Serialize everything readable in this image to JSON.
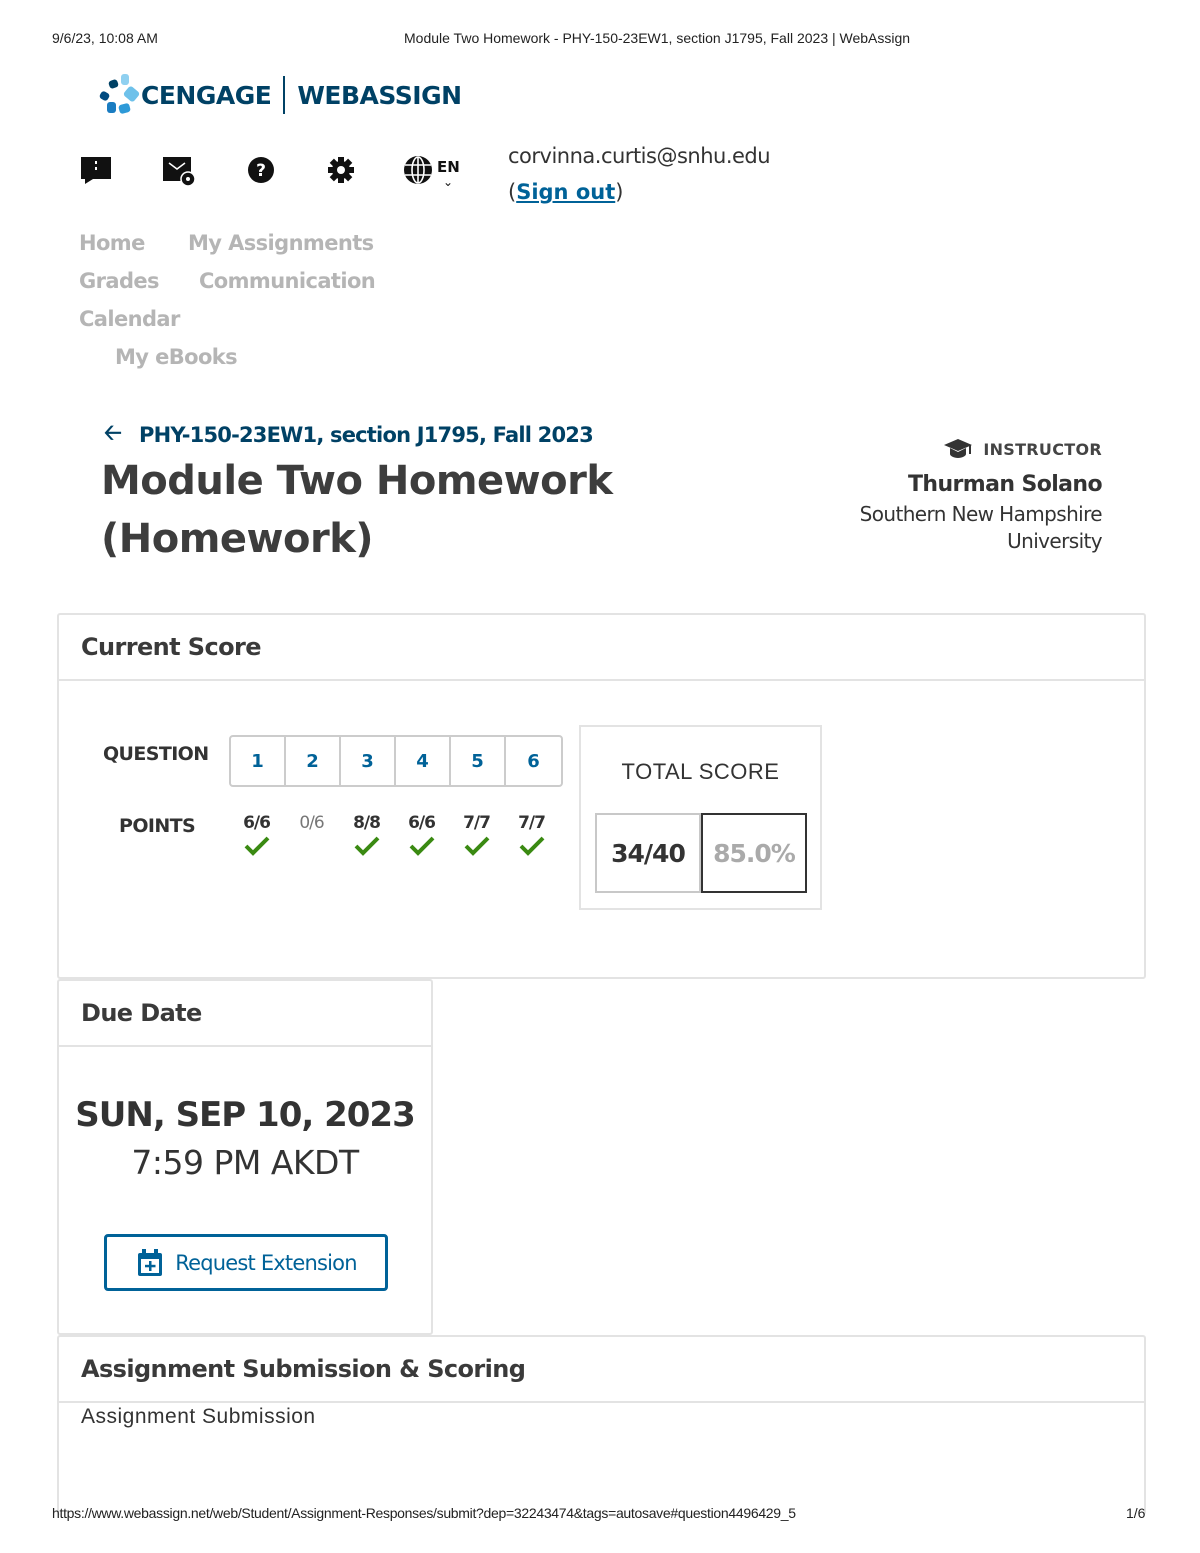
{
  "print_header": {
    "timestamp": "9/6/23, 10:08 AM",
    "document_title": "Module Two Homework - PHY-150-23EW1, section J1795, Fall 2023 | WebAssign"
  },
  "logo": {
    "brand_left": "CENGAGE",
    "brand_right": "WEBASSIGN"
  },
  "toolbar": {
    "icons": [
      "flag-icon",
      "message-settings-icon",
      "help-icon",
      "gear-icon",
      "globe-icon"
    ],
    "language": "EN",
    "user_email": "corvinna.curtis@snhu.edu",
    "sign_out_label": "Sign out"
  },
  "nav": {
    "items": [
      {
        "label": "Home"
      },
      {
        "label": "My Assignments"
      },
      {
        "label": "Grades"
      },
      {
        "label": "Communication"
      },
      {
        "label": "Calendar"
      },
      {
        "label": "My eBooks"
      }
    ]
  },
  "course": {
    "breadcrumb": "PHY-150-23EW1, section J1795, Fall 2023",
    "title": "Module Two Homework (Homework)"
  },
  "instructor": {
    "label": "INSTRUCTOR",
    "name": "Thurman Solano",
    "school": "Southern New Hampshire University"
  },
  "current_score": {
    "heading": "Current Score",
    "question_label": "QUESTION",
    "points_label": "POINTS",
    "questions": [
      {
        "number": "1",
        "points": "6/6",
        "correct": true
      },
      {
        "number": "2",
        "points": "0/6",
        "correct": false
      },
      {
        "number": "3",
        "points": "8/8",
        "correct": true
      },
      {
        "number": "4",
        "points": "6/6",
        "correct": true
      },
      {
        "number": "5",
        "points": "7/7",
        "correct": true
      },
      {
        "number": "6",
        "points": "7/7",
        "correct": true
      }
    ],
    "total_label": "TOTAL SCORE",
    "total_fraction": "34/40",
    "total_percent": "85.0%"
  },
  "due_date": {
    "heading": "Due Date",
    "date": "SUN, SEP 10, 2023",
    "time": "7:59 PM AKDT",
    "extension_button": "Request Extension"
  },
  "submission": {
    "heading": "Assignment Submission & Scoring",
    "subheading": "Assignment Submission"
  },
  "print_footer": {
    "url": "https://www.webassign.net/web/Student/Assignment-Responses/submit?dep=32243474&tags=autosave#question4496429_5",
    "page": "1/6"
  },
  "colors": {
    "brand_navy": "#004165",
    "link_blue": "#006298",
    "check_green": "#3a8a12",
    "nav_gray": "#b5b5b5"
  }
}
